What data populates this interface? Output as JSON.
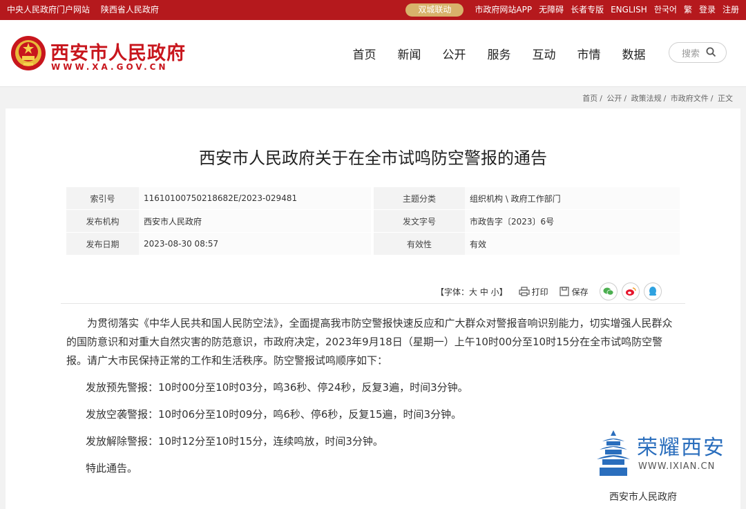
{
  "topbar": {
    "left_links": [
      "中央人民政府门户网站",
      "陕西省人民政府"
    ],
    "pill": "双城联动",
    "right_links": [
      "市政府网站APP",
      "无障碍",
      "长者专版",
      "ENGLISH",
      "한국어",
      "繁",
      "登录",
      "注册"
    ]
  },
  "header": {
    "site_title": "西安市人民政府",
    "site_url": "WWW.XA.GOV.CN",
    "nav": [
      "首页",
      "新闻",
      "公开",
      "服务",
      "互动",
      "市情",
      "数据"
    ],
    "search_placeholder": "搜索"
  },
  "breadcrumb": [
    "首页",
    "公开",
    "政策法规",
    "市政府文件",
    "正文"
  ],
  "article": {
    "title": "西安市人民政府关于在全市试鸣防空警报的通告",
    "meta": [
      [
        "索引号",
        "11610100750218682E/2023-029481",
        "主题分类",
        "组织机构 \\ 政府工作部门"
      ],
      [
        "发布机构",
        "西安市人民政府",
        "发文字号",
        "市政告字〔2023〕6号"
      ],
      [
        "发布日期",
        "2023-08-30 08:57",
        "有效性",
        "有效"
      ]
    ],
    "tools": {
      "font": "【字体：大 中 小】",
      "print": "打印",
      "save": "保存"
    },
    "intro": "为贯彻落实《中华人民共和国人民防空法》，全面提高我市防空警报快速反应和广大群众对警报音响识别能力，切实增强人民群众的国防意识和对重大自然灾害的防范意识，市政府决定，2023年9月18日（星期一）上午10时00分至10时15分在全市试鸣防空警报。请广大市民保持正常的工作和生活秩序。防空警报试鸣顺序如下：",
    "items": [
      "发放预先警报：10时00分至10时03分，鸣36秒、停24秒，反复3遍，时间3分钟。",
      "发放空袭警报：10时06分至10时09分，鸣6秒、停6秒，反复15遍，时间3分钟。",
      "发放解除警报：10时12分至10时15分，连续鸣放，时间3分钟。",
      "特此通告。"
    ],
    "signature": "西安市人民政府"
  },
  "watermark": {
    "text": "荣耀西安",
    "url": "WWW.IXIAN.CN"
  }
}
